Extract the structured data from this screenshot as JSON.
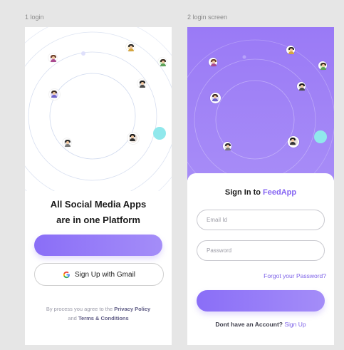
{
  "frames": {
    "login": {
      "label": "1 login",
      "title_line1": "All Social Media Apps",
      "title_line2": "are in one Platform",
      "google_button_label": "Sign Up with Gmail",
      "terms_prefix": "By process you agree to the",
      "privacy_link": "Privacy Policy",
      "terms_and": "and",
      "terms_link": "Terms & Conditions"
    },
    "login_screen": {
      "label": "2 login screen",
      "title_prefix": "Sign In to",
      "brand": "FeedApp",
      "email_placeholder": "Email Id",
      "password_placeholder": "Password",
      "forgot_label": "Forgot your Password?",
      "no_account_text": "Dont have an Account?",
      "signup_link": "Sign Up"
    }
  },
  "colors": {
    "accent": "#8463f2",
    "button_gradient_start": "#8a6ef7",
    "button_gradient_end": "#a48df8",
    "teal_dot": "#90e8ec",
    "background": "#e6e6e6"
  },
  "icons": {
    "google": "google-g-icon",
    "avatars": "avatar-photo"
  }
}
